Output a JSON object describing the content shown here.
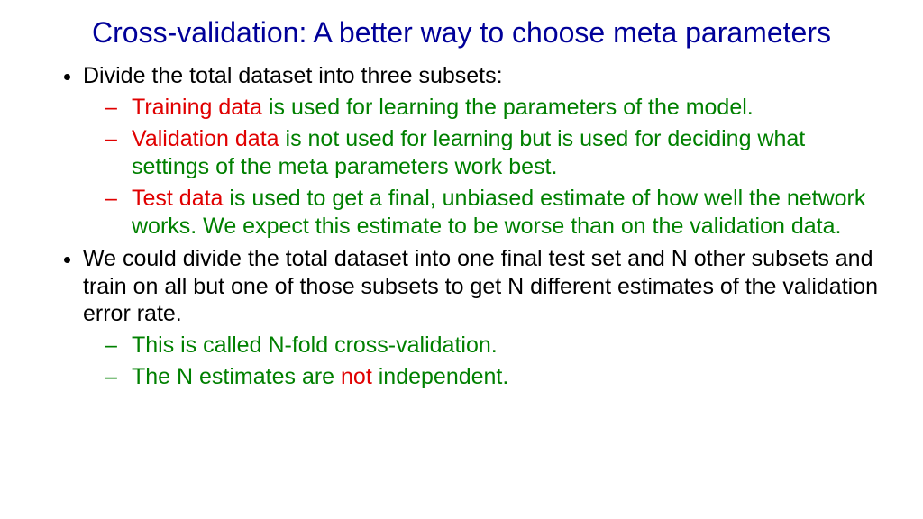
{
  "title": "Cross-validation: A better way to choose meta parameters",
  "bullets": {
    "b1": "Divide the total dataset into three subsets:",
    "s1_red": "Training data",
    "s1_green": " is used for learning the parameters of the model.",
    "s2_red": "Validation data",
    "s2_green": " is not used for learning but is used for deciding what settings of the meta parameters work best.",
    "s3_red": "Test data",
    "s3_green": " is used to get a final, unbiased estimate of how well the network works. We expect this estimate to be worse than on the validation data.",
    "b2": "We could divide the total dataset into one final test set and N other subsets and train on all but one of those subsets to get N different estimates of the validation error rate.",
    "s4": "This is called N-fold cross-validation.",
    "s5_pre": "The N estimates are ",
    "s5_red": "not",
    "s5_post": " independent."
  }
}
